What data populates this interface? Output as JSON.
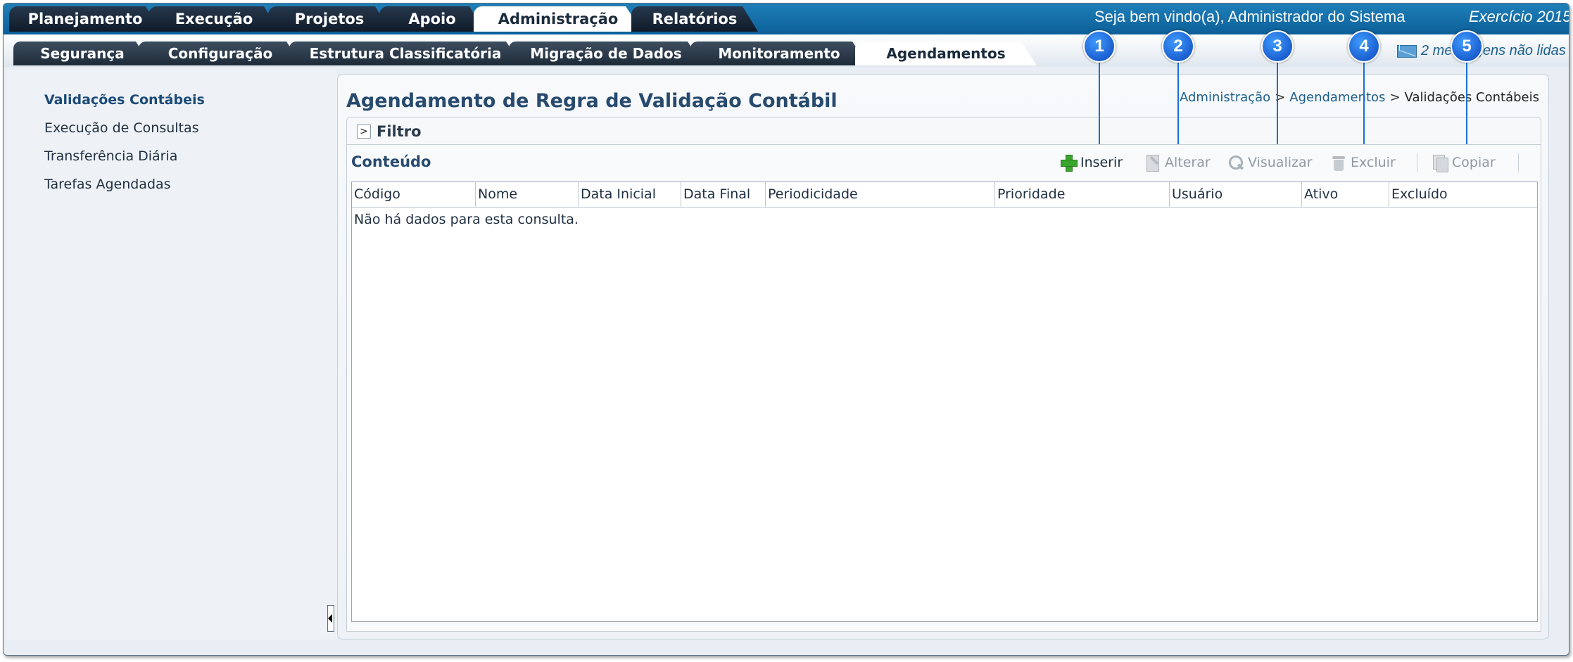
{
  "global_tabs": [
    {
      "label": "Planejamento"
    },
    {
      "label": "Execução"
    },
    {
      "label": "Projetos"
    },
    {
      "label": "Apoio"
    },
    {
      "label": "Administração"
    },
    {
      "label": "Relatórios"
    }
  ],
  "header": {
    "welcome": "Seja bem vindo(a), Administrador do Sistema",
    "exercise": "Exercício 2015",
    "messages": "2 mensagens não lidas"
  },
  "sub_tabs": [
    {
      "label": "Segurança"
    },
    {
      "label": "Configuração"
    },
    {
      "label": "Estrutura Classificatória"
    },
    {
      "label": "Migração de Dados"
    },
    {
      "label": "Monitoramento"
    },
    {
      "label": "Agendamentos"
    }
  ],
  "sidebar": {
    "items": [
      {
        "label": "Validações Contábeis"
      },
      {
        "label": "Execução de Consultas"
      },
      {
        "label": "Transferência Diária"
      },
      {
        "label": "Tarefas Agendadas"
      }
    ]
  },
  "main": {
    "title": "Agendamento de Regra de Validação Contábil",
    "breadcrumb": [
      "Administração",
      "Agendamentos",
      "Validações Contábeis"
    ],
    "breadcrumb_sep": ">",
    "filter_label": "Filtro",
    "filter_toggle": ">",
    "content_label": "Conteúdo",
    "toolbar": {
      "insert": "Inserir",
      "edit": "Alterar",
      "view": "Visualizar",
      "delete": "Excluir",
      "copy": "Copiar"
    },
    "table": {
      "columns": [
        "Código",
        "Nome",
        "Data Inicial",
        "Data Final",
        "Periodicidade",
        "Prioridade",
        "Usuário",
        "Ativo",
        "Excluído"
      ],
      "empty_message": "Não há dados para esta consulta."
    }
  },
  "callouts": [
    "1",
    "2",
    "3",
    "4",
    "5"
  ],
  "colors": {
    "header_blue": "#0c5f98",
    "tab_dark": "#1d2a38",
    "title_blue": "#274a6d",
    "callout_blue": "#1b5fcf",
    "insert_green": "#3aa52e"
  }
}
